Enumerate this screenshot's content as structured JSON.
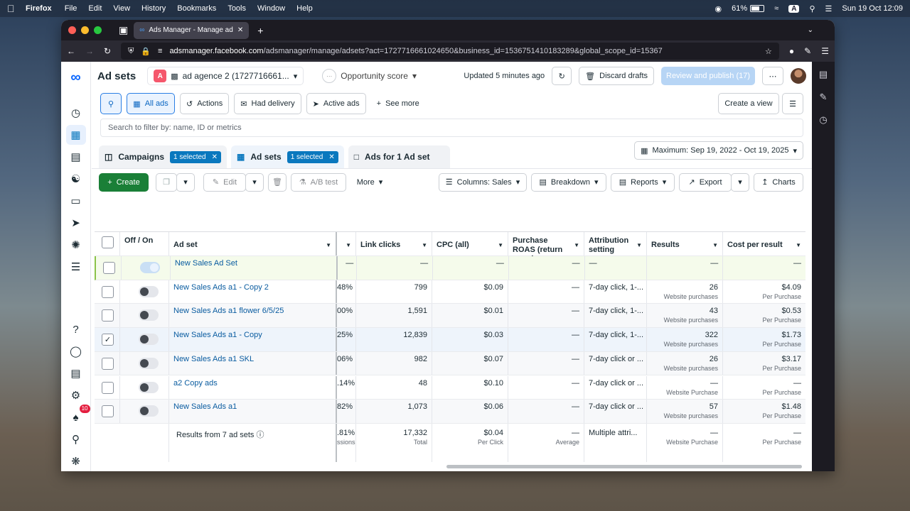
{
  "menubar": {
    "app": "Firefox",
    "items": [
      "File",
      "Edit",
      "View",
      "History",
      "Bookmarks",
      "Tools",
      "Window",
      "Help"
    ],
    "battery": "61%",
    "input_source": "A",
    "datetime": "Sun 19 Oct  12:09"
  },
  "browser": {
    "tab_title": "Ads Manager - Manage ads - C",
    "url_host": "adsmanager.facebook.com",
    "url_rest": "/adsmanager/manage/adsets?act=1727716661024650&business_id=1536751410183289&global_scope_id=15367"
  },
  "header": {
    "title": "Ad sets",
    "account_badge": "A",
    "account_name": "ad agence 2 (17277166​61...",
    "opportunity": "Opportunity score",
    "updated": "Updated 5 minutes ago",
    "discard": "Discard drafts",
    "publish": "Review and publish (17)"
  },
  "filters": {
    "all_ads": "All ads",
    "actions": "Actions",
    "had_delivery": "Had delivery",
    "active_ads": "Active ads",
    "see_more": "See more",
    "create_view": "Create a view",
    "search_placeholder": "Search to filter by: name, ID or metrics"
  },
  "levels": {
    "campaigns": "Campaigns",
    "campaigns_selected": "1 selected",
    "adsets": "Ad sets",
    "adsets_selected": "1 selected",
    "ads": "Ads for 1 Ad set",
    "date_range": "Maximum: Sep 19, 2022 - Oct 19, 2025"
  },
  "toolbar": {
    "create": "Create",
    "edit": "Edit",
    "ab_test": "A/B test",
    "more": "More",
    "columns": "Columns: Sales",
    "breakdown": "Breakdown",
    "reports": "Reports",
    "export": "Export",
    "charts": "Charts"
  },
  "table": {
    "headers": {
      "onoff": "Off / On",
      "adset": "Ad set",
      "link_clicks": "Link clicks",
      "cpc": "CPC (all)",
      "roas": "Purchase ROAS (return on ad...",
      "attribution": "Attribution setting",
      "results": "Results",
      "cost": "Cost per result"
    },
    "rows": [
      {
        "name": "New Sales Ad Set",
        "pct": "—",
        "clicks": "—",
        "cpc": "—",
        "roas": "—",
        "attr": "—",
        "results": "—",
        "results_sub": "",
        "cost": "—",
        "cost_sub": "",
        "checked": "",
        "toggle": "light"
      },
      {
        "name": "New Sales Ads a1 - Copy 2",
        "pct": "48%",
        "clicks": "799",
        "cpc": "$0.09",
        "roas": "—",
        "attr": "7-day click, 1-...",
        "results": "26",
        "results_sub": "Website purchases",
        "cost": "$4.09",
        "cost_sub": "Per Purchase",
        "checked": "",
        "toggle": "off"
      },
      {
        "name": "New Sales Ads a1 flower 6/5/25",
        "pct": "00%",
        "clicks": "1,591",
        "cpc": "$0.01",
        "roas": "—",
        "attr": "7-day click, 1-...",
        "results": "43",
        "results_sub": "Website purchases",
        "cost": "$0.53",
        "cost_sub": "Per Purchase",
        "checked": "",
        "toggle": "off"
      },
      {
        "name": "New Sales Ads a1 - Copy",
        "pct": "25%",
        "clicks": "12,839",
        "cpc": "$0.03",
        "roas": "—",
        "attr": "7-day click, 1-...",
        "results": "322",
        "results_sub": "Website purchases",
        "cost": "$1.73",
        "cost_sub": "Per Purchase",
        "checked": "✓",
        "toggle": "off"
      },
      {
        "name": "New Sales Ads a1 SKL",
        "pct": "06%",
        "clicks": "982",
        "cpc": "$0.07",
        "roas": "—",
        "attr": "7-day click or ...",
        "results": "26",
        "results_sub": "Website purchases",
        "cost": "$3.17",
        "cost_sub": "Per Purchase",
        "checked": "",
        "toggle": "off"
      },
      {
        "name": "a2 Copy ads",
        "pct": ".14%",
        "clicks": "48",
        "cpc": "$0.10",
        "roas": "—",
        "attr": "7-day click or ...",
        "results": "—",
        "results_sub": "Website Purchase",
        "cost": "—",
        "cost_sub": "Per Purchase",
        "checked": "",
        "toggle": "off"
      },
      {
        "name": "New Sales Ads a1",
        "pct": "82%",
        "clicks": "1,073",
        "cpc": "$0.06",
        "roas": "—",
        "attr": "7-day click or ...",
        "results": "57",
        "results_sub": "Website purchases",
        "cost": "$1.48",
        "cost_sub": "Per Purchase",
        "checked": "",
        "toggle": "off"
      }
    ],
    "total": {
      "label": "Results from 7 ad sets",
      "pct": ".81%",
      "pct_sub": "ssions",
      "clicks": "17,332",
      "clicks_sub": "Total",
      "cpc": "$0.04",
      "cpc_sub": "Per Click",
      "roas": "—",
      "roas_sub": "Average",
      "attr": "Multiple attri...",
      "results": "—",
      "results_sub": "Website Purchase",
      "cost": "—",
      "cost_sub": "Per Purchase"
    }
  },
  "rail": {
    "notification_count": "10"
  },
  "colors": {
    "accent": "#0a78be",
    "create_green": "#1a7f37",
    "link": "#0a5ca0"
  }
}
